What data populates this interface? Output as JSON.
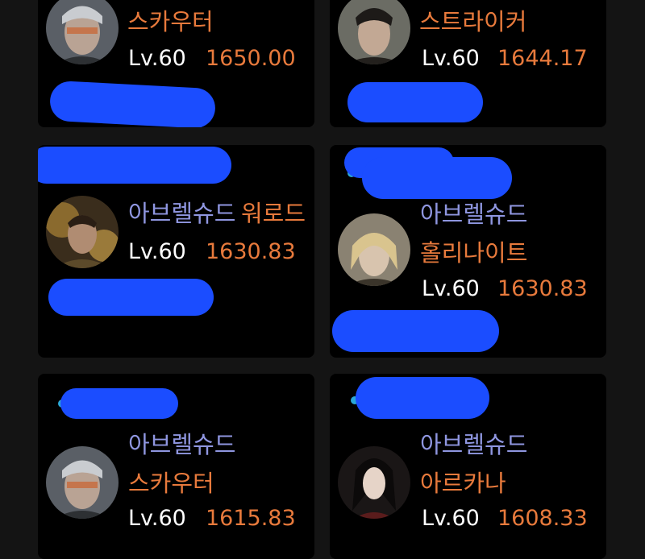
{
  "colors": {
    "page_bg": "#141414",
    "card_bg": "#000000",
    "server_text": "#8f96e0",
    "class_text": "#e87a3c",
    "level_text": "#ffffff",
    "redaction": "#1b4dff"
  },
  "cards": [
    {
      "server": "",
      "class": "스카우터",
      "level": "Lv.60",
      "item_level": "1650.00",
      "avatar_icon": "scouter-portrait-icon"
    },
    {
      "server": "",
      "class": "스트라이커",
      "level": "Lv.60",
      "item_level": "1644.17",
      "avatar_icon": "striker-portrait-icon"
    },
    {
      "server": "아브렐슈드",
      "class": "워로드",
      "level": "Lv.60",
      "item_level": "1630.83",
      "avatar_icon": "warlord-portrait-icon"
    },
    {
      "server": "아브렐슈드",
      "class": "홀리나이트",
      "level": "Lv.60",
      "item_level": "1630.83",
      "avatar_icon": "holyknight-portrait-icon"
    },
    {
      "server": "아브렐슈드",
      "class": "스카우터",
      "level": "Lv.60",
      "item_level": "1615.83",
      "avatar_icon": "scouter-portrait-icon"
    },
    {
      "server": "아브렐슈드",
      "class": "아르카나",
      "level": "Lv.60",
      "item_level": "1608.33",
      "avatar_icon": "arcana-portrait-icon"
    }
  ]
}
